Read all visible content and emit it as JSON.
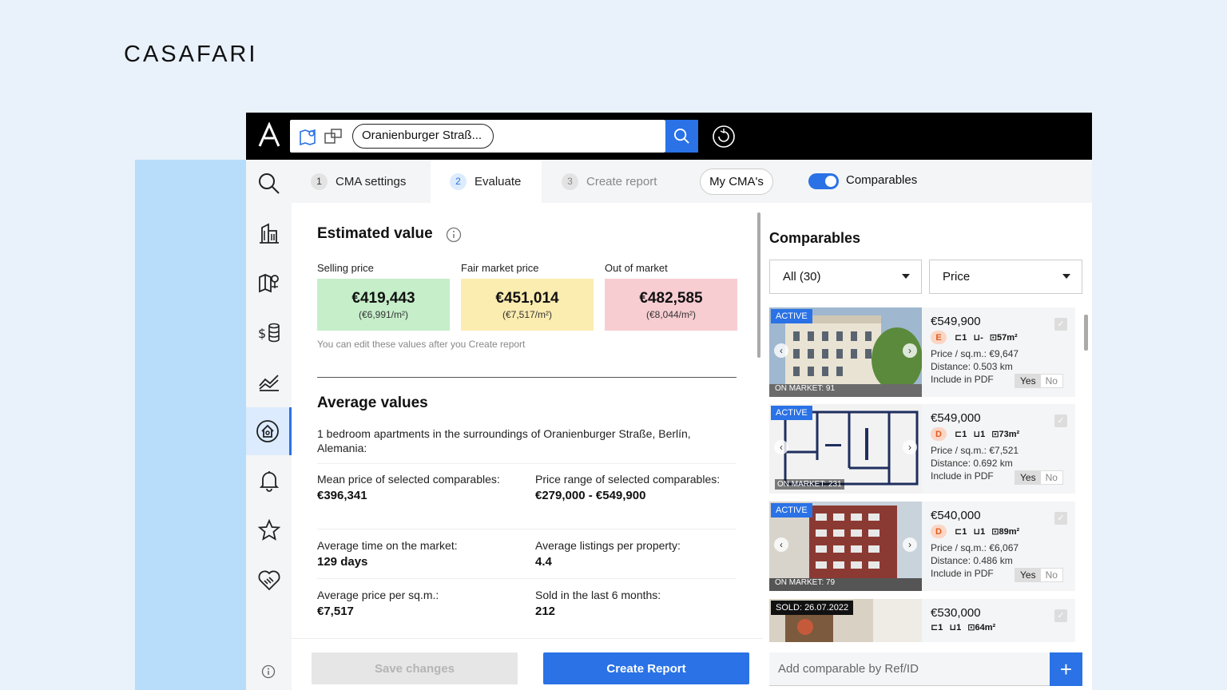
{
  "brand": {
    "name": "CASAFARI"
  },
  "topbar": {
    "search_chip": "Oranienburger Straß...",
    "icons": [
      "app-logo-icon",
      "map-pin-icon",
      "multi-listing-icon",
      "search-icon",
      "refresh-icon"
    ]
  },
  "sidebar": {
    "items": [
      {
        "name": "search-icon",
        "active": false
      },
      {
        "name": "building-icon",
        "active": false
      },
      {
        "name": "map-icon",
        "active": false
      },
      {
        "name": "money-icon",
        "active": false
      },
      {
        "name": "chart-icon",
        "active": false
      },
      {
        "name": "home-valuation-icon",
        "active": true
      },
      {
        "name": "bell-icon",
        "active": false
      },
      {
        "name": "star-icon",
        "active": false
      },
      {
        "name": "handshake-icon",
        "active": false
      }
    ]
  },
  "tabs": [
    {
      "num": "1",
      "label": "CMA settings",
      "state": "normal"
    },
    {
      "num": "2",
      "label": "Evaluate",
      "state": "active"
    },
    {
      "num": "3",
      "label": "Create report",
      "state": "disabled"
    }
  ],
  "my_cma_label": "My CMA's",
  "comparables_toggle_label": "Comparables",
  "estimated": {
    "title": "Estimated value",
    "boxes": [
      {
        "label": "Selling price",
        "value": "€419,443",
        "per_m2": "(€6,991/m²)",
        "color": "#c5eec9"
      },
      {
        "label": "Fair market price",
        "value": "€451,014",
        "per_m2": "(€7,517/m²)",
        "color": "#fbecb0"
      },
      {
        "label": "Out of market",
        "value": "€482,585",
        "per_m2": "(€8,044/m²)",
        "color": "#f7cdd2"
      }
    ],
    "note": "You can edit these values after you Create report"
  },
  "average": {
    "title": "Average values",
    "description": "1 bedroom apartments in the surroundings of Oranienburger Straße, Berlín, Alemania:",
    "stats": [
      {
        "label": "Mean price of selected comparables:",
        "value": "€396,341"
      },
      {
        "label": "Price range of selected comparables:",
        "value": "€279,000 - €549,900"
      },
      {
        "label": "Average time on the market:",
        "value": "129 days"
      },
      {
        "label": "Average listings per property:",
        "value": "4.4"
      },
      {
        "label": "Average price per sq.m.:",
        "value": "€7,517"
      },
      {
        "label": "Sold in the last 6 months:",
        "value": "212"
      }
    ]
  },
  "buttons": {
    "save": "Save changes",
    "create": "Create Report"
  },
  "comparables": {
    "title": "Comparables",
    "filter_selected": "All (30)",
    "sort_selected": "Price",
    "cards": [
      {
        "status": "ACTIVE",
        "market": "ON MARKET: 91",
        "price": "€549,900",
        "energy": "E",
        "beds": "1",
        "baths": "-",
        "area": "57m²",
        "ppsqm": "Price / sq.m.: €9,647",
        "distance": "Distance: 0.503 km",
        "pdf_label": "Include in PDF",
        "yes": "Yes",
        "no": "No"
      },
      {
        "status": "ACTIVE",
        "market": "ON MARKET: 231",
        "price": "€549,000",
        "energy": "D",
        "beds": "1",
        "baths": "1",
        "area": "73m²",
        "ppsqm": "Price / sq.m.: €7,521",
        "distance": "Distance: 0.692 km",
        "pdf_label": "Include in PDF",
        "yes": "Yes",
        "no": "No"
      },
      {
        "status": "ACTIVE",
        "market": "ON MARKET: 79",
        "price": "€540,000",
        "energy": "D",
        "beds": "1",
        "baths": "1",
        "area": "89m²",
        "ppsqm": "Price / sq.m.: €6,067",
        "distance": "Distance: 0.486 km",
        "pdf_label": "Include in PDF",
        "yes": "Yes",
        "no": "No"
      },
      {
        "status": "SOLD: 26.07.2022",
        "market": "",
        "price": "€530,000",
        "energy": "",
        "beds": "1",
        "baths": "1",
        "area": "64m²"
      }
    ],
    "add_placeholder": "Add comparable by Ref/ID",
    "add_button": "+"
  }
}
